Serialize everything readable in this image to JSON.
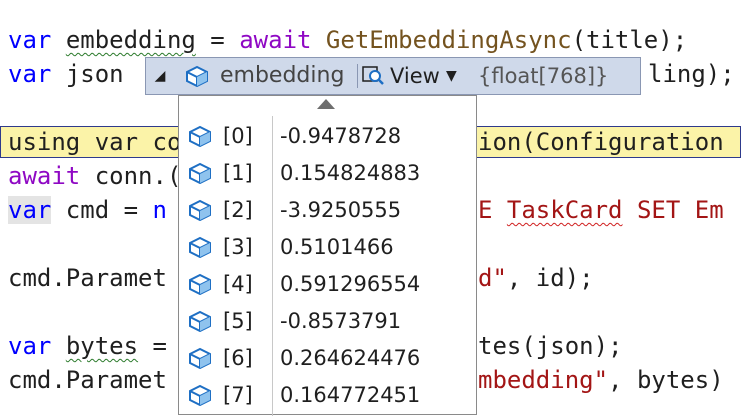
{
  "code": {
    "line1": {
      "kw": "var",
      "name": "embedding",
      "eq": " = ",
      "kw2": "await",
      "fn": "GetEmbeddingAsync",
      "rest": "(title);"
    },
    "line2": {
      "kw": "var",
      "name": "json",
      "tail": "ling);"
    },
    "line3": {
      "text": "using var co",
      "tail": "ion(Configuration"
    },
    "line4": {
      "kw": "await",
      "text": " conn.("
    },
    "line5": {
      "kw": "var",
      "text": " cmd = ",
      "kw2": "n",
      "tail1": "E ",
      "ty": "TaskCard",
      "tail2": " SET Em"
    },
    "line6": {
      "text": "cmd.Paramet",
      "str": "d\"",
      "tail": ", id);"
    },
    "line7": {
      "kw": "var",
      "name": "bytes",
      "text": " = ",
      "tail": "tes(json);"
    },
    "line8": {
      "text": "cmd.Paramet",
      "str": "mbedding\"",
      "tail": ", bytes)"
    }
  },
  "datatip": {
    "name": "embedding",
    "view_label": "View",
    "value": "{float[768]}",
    "rows": [
      {
        "index": "[0]",
        "value": "-0.9478728"
      },
      {
        "index": "[1]",
        "value": "0.154824883"
      },
      {
        "index": "[2]",
        "value": "-3.9250555"
      },
      {
        "index": "[3]",
        "value": "0.5101466"
      },
      {
        "index": "[4]",
        "value": "0.591296554"
      },
      {
        "index": "[5]",
        "value": "-0.8573791"
      },
      {
        "index": "[6]",
        "value": "0.264624476"
      },
      {
        "index": "[7]",
        "value": "0.164772451"
      }
    ]
  },
  "colors": {
    "keyword": "#0000ff",
    "await": "#8f08c4",
    "method": "#74531f",
    "string": "#a31515",
    "highlight": "#fbf3a8"
  },
  "icons": [
    "cube-icon",
    "magnifier-icon",
    "caret-down-icon",
    "expand-arrow-icon",
    "scroll-up-icon"
  ]
}
